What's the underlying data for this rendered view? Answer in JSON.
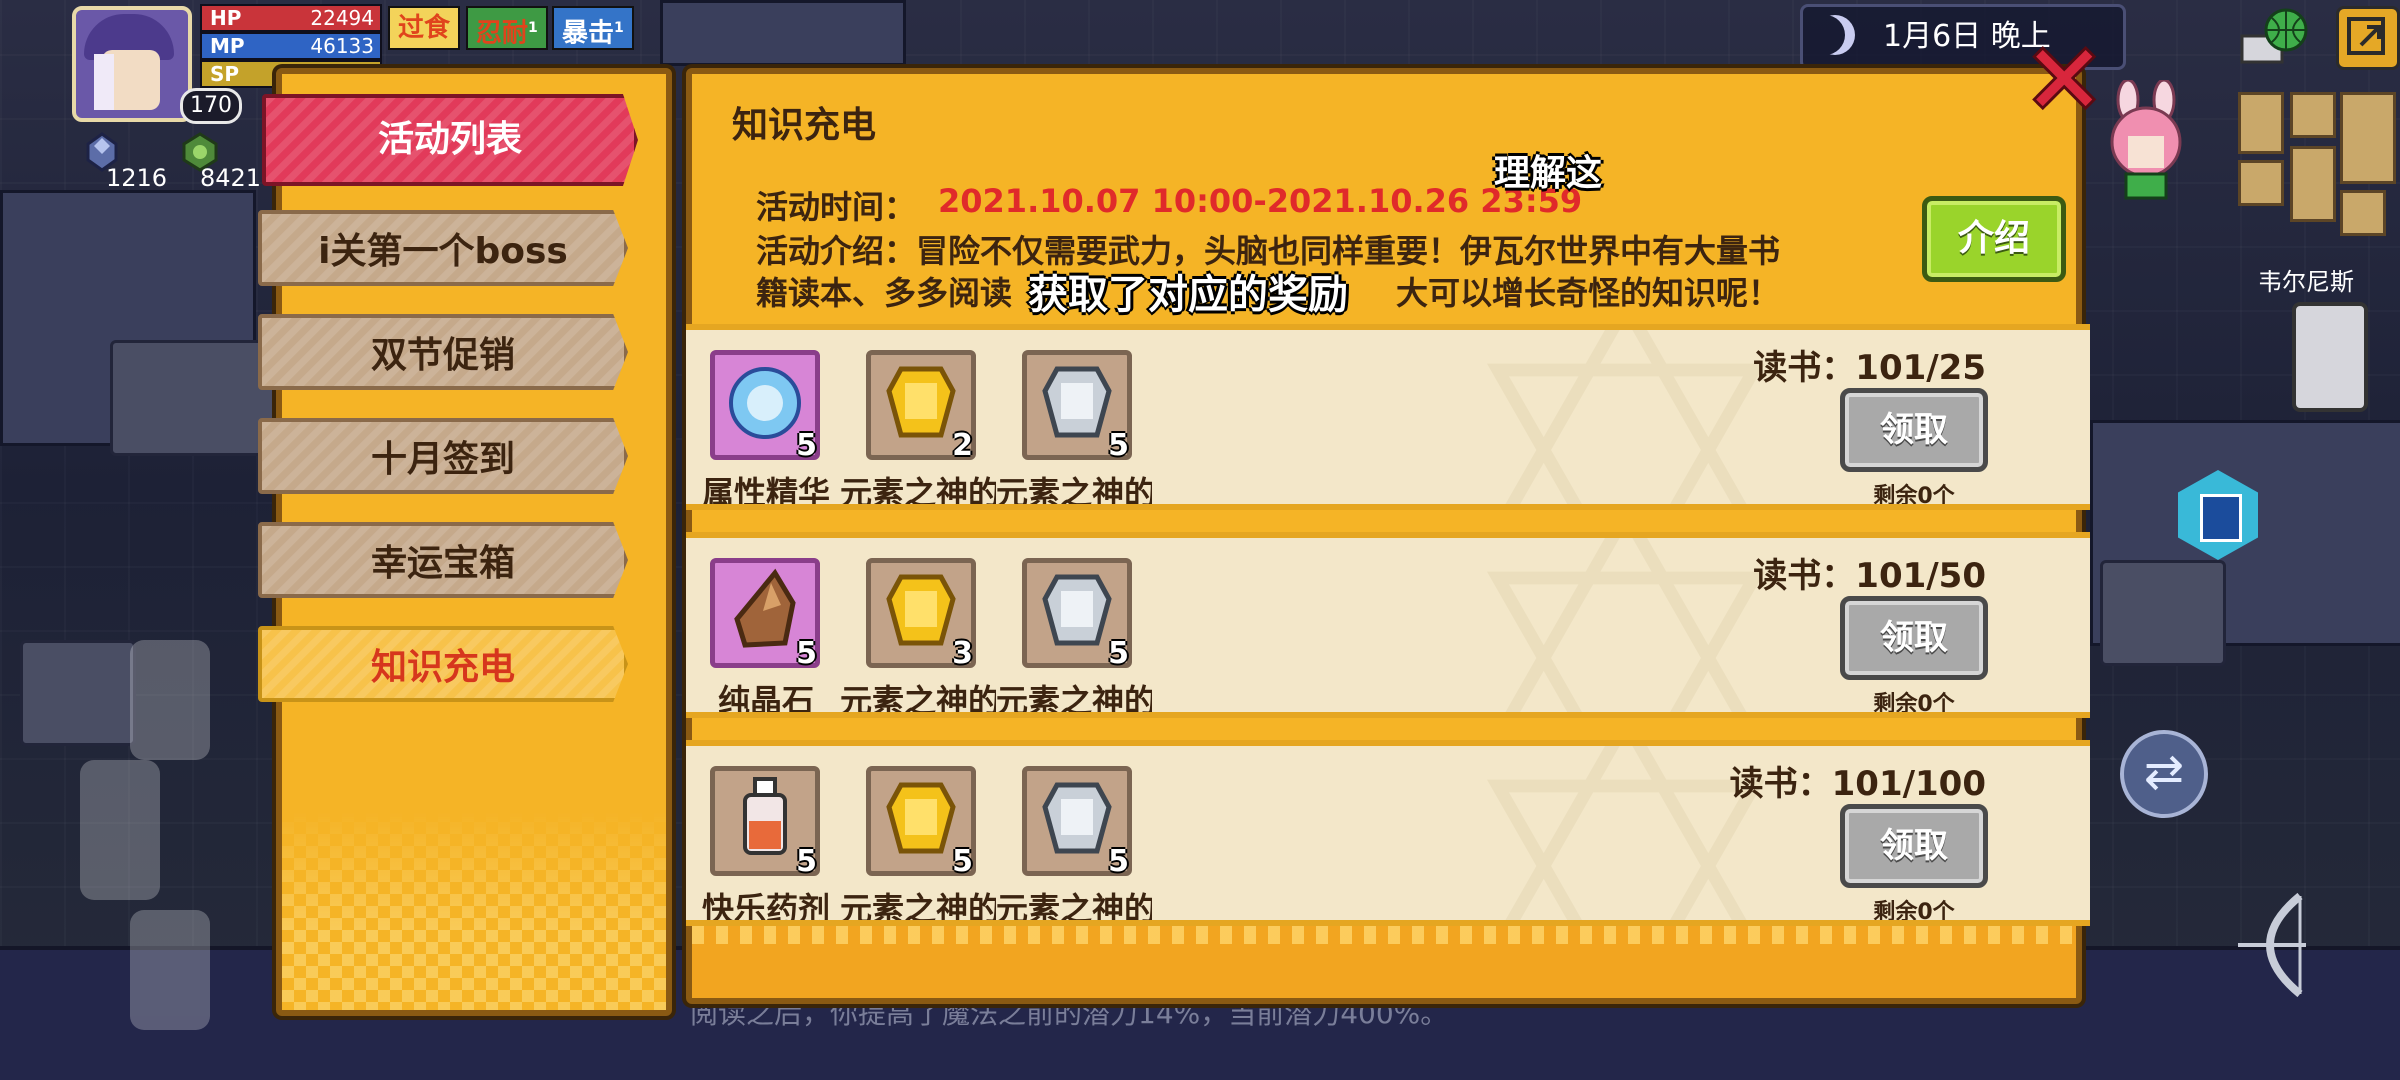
{
  "hud": {
    "level": "170",
    "stats": [
      {
        "label": "HP",
        "value": "22494",
        "color": "#e8464a"
      },
      {
        "label": "MP",
        "value": "46133",
        "color": "#3b7ee6"
      },
      {
        "label": "SP",
        "value": "0.1",
        "color": "#e6c23b"
      }
    ],
    "buffs": [
      {
        "label": "过食",
        "count": "",
        "color": "#e08a20"
      },
      {
        "label": "忍耐",
        "count": "1",
        "color": "#3ea84a"
      },
      {
        "label": "暴击",
        "count": "1",
        "color": "#3b7ee6"
      }
    ],
    "resources": [
      {
        "icon": "crystal-icon",
        "value": "1216"
      },
      {
        "icon": "gem-icon",
        "value": "8421"
      }
    ],
    "clock": "1月6日 晚上",
    "npc_name": "韦尔尼斯"
  },
  "menu": {
    "items": [
      {
        "label": "活动列表",
        "state": "header"
      },
      {
        "label": "i关第一个boss",
        "state": "normal"
      },
      {
        "label": "双节促销",
        "state": "normal"
      },
      {
        "label": "十月签到",
        "state": "normal"
      },
      {
        "label": "幸运宝箱",
        "state": "normal"
      },
      {
        "label": "知识充电",
        "state": "selected"
      }
    ]
  },
  "panel": {
    "title": "知识充电",
    "time_label": "活动时间：",
    "time_value": "2021.10.07 10:00-2021.10.26 23:59",
    "intro_line1": "活动介绍：冒险不仅需要武力，头脑也同样重要！伊瓦尔世界中有大量书",
    "intro_line2": "籍读本、多多阅读　　　　　　　　　　　　大可以增长奇怪的知识呢！",
    "intro_button": "介绍",
    "subtitle_top": "理解这",
    "subtitle_mid": "获取了对应的奖励"
  },
  "tasks": [
    {
      "progress": "读书：101/25",
      "claim": "领取",
      "remain": "剩余0个",
      "rewards": [
        {
          "name": "属性精华",
          "count": "5",
          "icon": "orb-icon",
          "frame": "purple"
        },
        {
          "name": "元素之神的",
          "count": "2",
          "icon": "gold-emblem-icon",
          "frame": "brown"
        },
        {
          "name": "元素之神的",
          "count": "5",
          "icon": "silver-emblem-icon",
          "frame": "brown"
        }
      ]
    },
    {
      "progress": "读书：101/50",
      "claim": "领取",
      "remain": "剩余0个",
      "rewards": [
        {
          "name": "纯晶石",
          "count": "5",
          "icon": "crystal-ore-icon",
          "frame": "purple"
        },
        {
          "name": "元素之神的",
          "count": "3",
          "icon": "gold-emblem-icon",
          "frame": "brown"
        },
        {
          "name": "元素之神的",
          "count": "5",
          "icon": "silver-emblem-icon",
          "frame": "brown"
        }
      ]
    },
    {
      "progress": "读书：101/100",
      "claim": "领取",
      "remain": "剩余0个",
      "rewards": [
        {
          "name": "快乐药剂",
          "count": "5",
          "icon": "potion-icon",
          "frame": "brown"
        },
        {
          "name": "元素之神的",
          "count": "5",
          "icon": "gold-emblem-icon",
          "frame": "brown"
        },
        {
          "name": "元素之神的",
          "count": "5",
          "icon": "silver-emblem-icon",
          "frame": "brown"
        }
      ]
    }
  ],
  "footer_note": "阅读之后，你提高了魔法之前的潜力14%，当前潜力400%。"
}
